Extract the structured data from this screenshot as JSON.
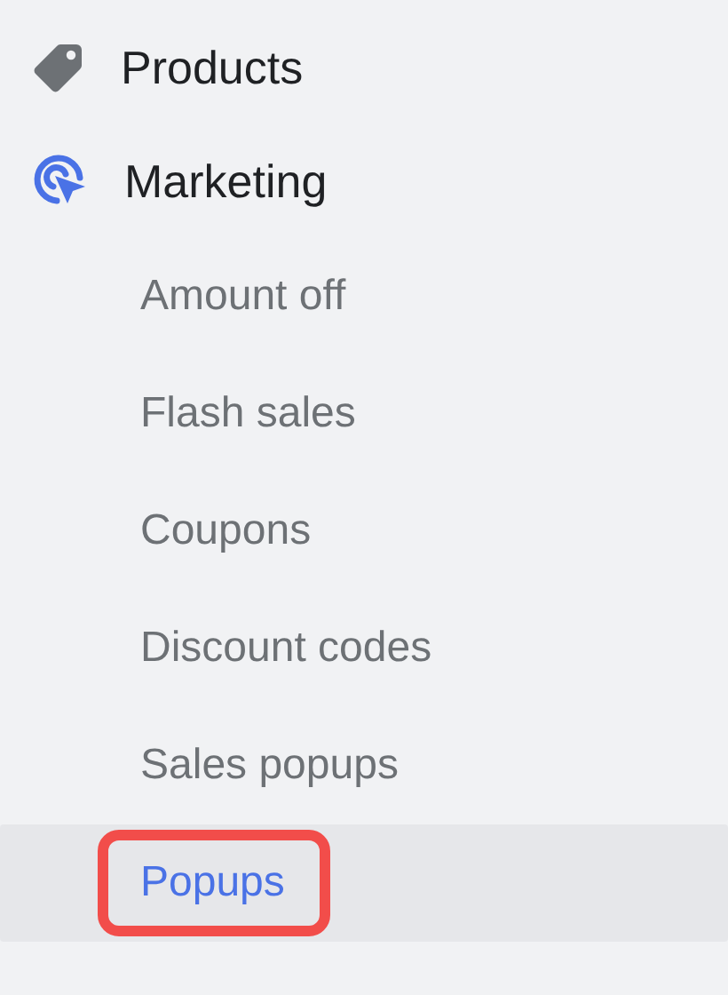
{
  "nav": [
    {
      "label": "Products",
      "kind": "tag"
    },
    {
      "label": "Marketing",
      "kind": "target",
      "children": [
        {
          "label": "Amount off",
          "selected": false,
          "highlighted": false
        },
        {
          "label": "Flash sales",
          "selected": false,
          "highlighted": false
        },
        {
          "label": "Coupons",
          "selected": false,
          "highlighted": false
        },
        {
          "label": "Discount codes",
          "selected": false,
          "highlighted": false
        },
        {
          "label": "Sales popups",
          "selected": false,
          "highlighted": false
        },
        {
          "label": "Popups",
          "selected": true,
          "highlighted": true
        }
      ]
    }
  ]
}
